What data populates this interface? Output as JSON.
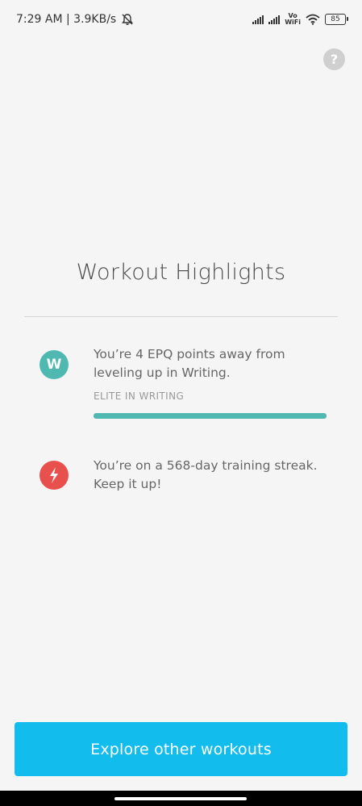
{
  "status_bar": {
    "time_speed": "7:29 AM | 3.9KB/s",
    "vowifi_top": "Vo",
    "vowifi_bottom": "WiFi",
    "battery": "85"
  },
  "help": {
    "label": "?"
  },
  "main": {
    "title": "Workout Highlights",
    "highlights": [
      {
        "icon_letter": "W",
        "icon": "writing-badge-icon",
        "color": "#4fb9b1",
        "text": "You’re 4 EPQ points away from leveling up in Writing.",
        "level_label": "ELITE IN WRITING",
        "progress_fraction": 1.0
      },
      {
        "icon": "lightning-icon",
        "color": "#e8504e",
        "text": "You’re on a 568-day training streak. Keep it up!"
      }
    ]
  },
  "footer": {
    "explore_label": "Explore other workouts",
    "accent": "#12bdee"
  }
}
